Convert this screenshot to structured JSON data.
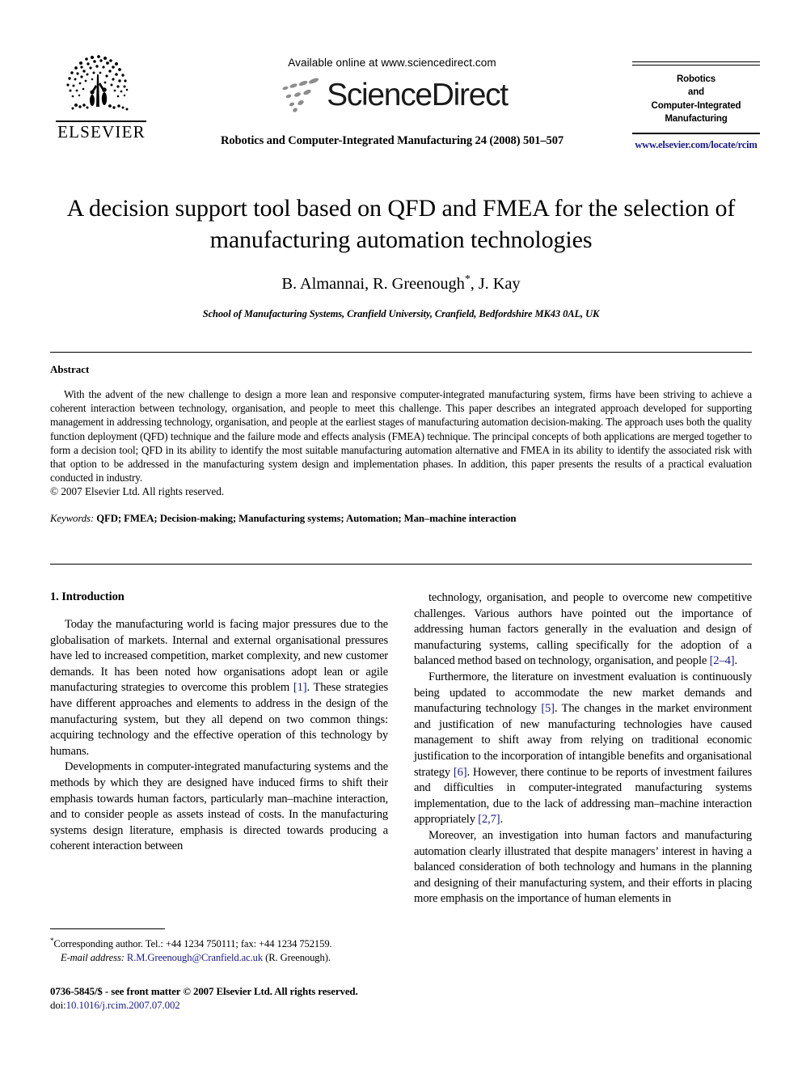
{
  "masthead": {
    "publisher_name": "ELSEVIER",
    "publisher_logo_icon": "elsevier-tree-logo",
    "available_online": "Available online at www.sciencedirect.com",
    "sciencedirect_wordmark": "ScienceDirect",
    "sciencedirect_logo_icon": "sciencedirect-swoosh-icon",
    "journal_reference": "Robotics and Computer-Integrated Manufacturing 24 (2008) 501–507",
    "journal_box": {
      "line1": "Robotics",
      "line2": "and",
      "line3": "Computer-Integrated",
      "line4": "Manufacturing",
      "url": "www.elsevier.com/locate/rcim"
    }
  },
  "title_block": {
    "title": "A decision support tool based on QFD and FMEA for the selection of manufacturing automation technologies",
    "authors_pre": "B. Almannai, R. Greenough",
    "authors_marker": "*",
    "authors_post": ", J. Kay",
    "affiliation": "School of Manufacturing Systems, Cranfield University, Cranfield, Bedfordshire MK43 0AL, UK"
  },
  "abstract": {
    "heading": "Abstract",
    "body": "With the advent of the new challenge to design a more lean and responsive computer-integrated manufacturing system, firms have been striving to achieve a coherent interaction between technology, organisation, and people to meet this challenge. This paper describes an integrated approach developed for supporting management in addressing technology, organisation, and people at the earliest stages of manufacturing automation decision-making. The approach uses both the quality function deployment (QFD) technique and the failure mode and effects analysis (FMEA) technique. The principal concepts of both applications are merged together to form a decision tool; QFD in its ability to identify the most suitable manufacturing automation alternative and FMEA in its ability to identify the associated risk with that option to be addressed in the manufacturing system design and implementation phases. In addition, this paper presents the results of a practical evaluation conducted in industry.",
    "copyright": "© 2007 Elsevier Ltd. All rights reserved.",
    "keywords_label": "Keywords:",
    "keywords_list": "QFD; FMEA; Decision-making; Manufacturing systems; Automation; Man–machine interaction"
  },
  "introduction": {
    "heading": "1.  Introduction",
    "left_paragraphs": [
      {
        "parts": [
          {
            "text": "Today the manufacturing world is facing major pressures due to the globalisation of markets. Internal and external organisational pressures have led to increased competition, market complexity, and new customer demands. It has been noted how organisations adopt lean or agile manufacturing strategies to overcome this problem ",
            "link": false
          },
          {
            "text": "[1]",
            "link": true
          },
          {
            "text": ". These strategies have different approaches and elements to address in the design of the manufacturing system, but they all depend on two common things: acquiring technology and the effective operation of this technology by humans.",
            "link": false
          }
        ]
      },
      {
        "parts": [
          {
            "text": "Developments in computer-integrated manufacturing systems and the methods by which they are designed have induced firms to shift their emphasis towards human factors, particularly man–machine interaction, and to consider people as assets instead of costs. In the manufacturing systems design literature, emphasis is directed towards producing a coherent interaction between",
            "link": false
          }
        ]
      }
    ],
    "right_paragraphs": [
      {
        "parts": [
          {
            "text": "technology, organisation, and people to overcome new competitive challenges. Various authors have pointed out the importance of addressing human factors generally in the evaluation and design of manufacturing systems, calling specifically for the adoption of a balanced method based on technology, organisation, and people ",
            "link": false
          },
          {
            "text": "[2–4]",
            "link": true
          },
          {
            "text": ".",
            "link": false
          }
        ]
      },
      {
        "parts": [
          {
            "text": "Furthermore, the literature on investment evaluation is continuously being updated to accommodate the new market demands and manufacturing technology ",
            "link": false
          },
          {
            "text": "[5]",
            "link": true
          },
          {
            "text": ". The changes in the market environment and justification of new manufacturing technologies have caused management to shift away from relying on traditional economic justification to the incorporation of intangible benefits and organisational strategy ",
            "link": false
          },
          {
            "text": "[6]",
            "link": true
          },
          {
            "text": ". However, there continue to be reports of investment failures and difficulties in computer-integrated manufacturing systems implementation, due to the lack of addressing man–machine interaction appropriately ",
            "link": false
          },
          {
            "text": "[2,7]",
            "link": true
          },
          {
            "text": ".",
            "link": false
          }
        ]
      },
      {
        "parts": [
          {
            "text": "Moreover, an investigation into human factors and manufacturing automation clearly illustrated that despite managers’ interest in having a balanced consideration of both technology and humans in the planning and designing of their manufacturing system, and their efforts in placing more emphasis on the importance of human elements in",
            "link": false
          }
        ]
      }
    ]
  },
  "footnotes": {
    "corresponding_marker": "*",
    "corresponding_text": "Corresponding author. Tel.: +44 1234 750111; fax: +44 1234 752159.",
    "email_label": "E-mail address:",
    "email_address": "R.M.Greenough@Cranfield.ac.uk",
    "email_suffix": "(R. Greenough)."
  },
  "imprint": {
    "line1_prefix": "0736-5845/$ - see front matter ",
    "line1_rest": "© 2007 Elsevier Ltd. All rights reserved.",
    "doi_label": "doi:",
    "doi_value": "10.1016/j.rcim.2007.07.002"
  },
  "colors": {
    "link": "#1a1a8c",
    "text": "#000000",
    "sd_gray": "#8c8c8c"
  }
}
